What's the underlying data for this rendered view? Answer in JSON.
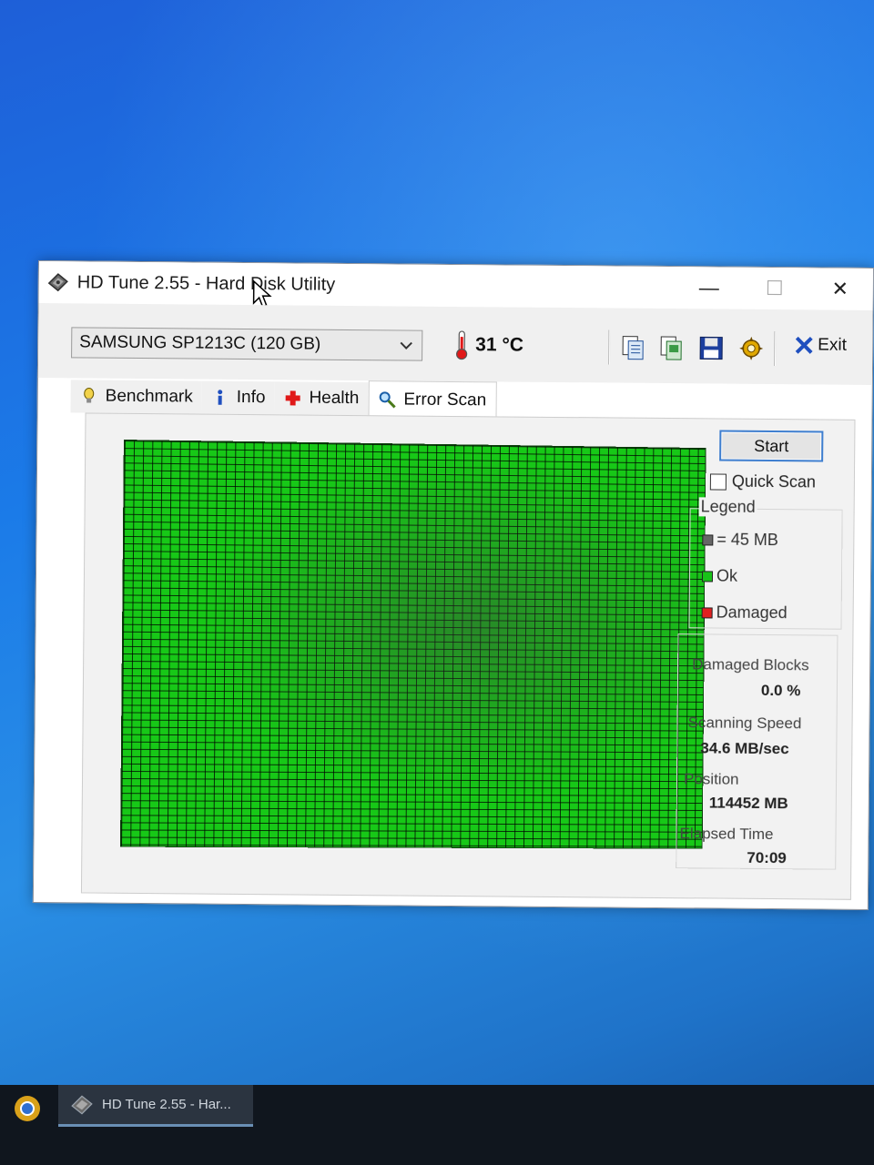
{
  "window": {
    "title": "HD Tune 2.55 - Hard Disk Utility",
    "minimize": "—",
    "maximize": "☐",
    "close": "✕"
  },
  "toolbar": {
    "drive": "SAMSUNG SP1213C (120 GB)",
    "temperature": "31 °C",
    "exit_label": "Exit",
    "icons": [
      "copy-info-icon",
      "copy-screenshot-icon",
      "save-icon",
      "options-icon"
    ]
  },
  "tabs": [
    {
      "label": "Benchmark",
      "icon": "lightbulb-icon"
    },
    {
      "label": "Info",
      "icon": "info-icon"
    },
    {
      "label": "Health",
      "icon": "health-cross-icon"
    },
    {
      "label": "Error Scan",
      "icon": "magnifier-icon",
      "active": true
    }
  ],
  "error_scan": {
    "start_label": "Start",
    "quick_scan_label": "Quick Scan",
    "quick_scan_checked": false,
    "legend_title": "Legend",
    "legend": [
      {
        "label": "= 45 MB",
        "color": "#666666"
      },
      {
        "label": "Ok",
        "color": "#19c219"
      },
      {
        "label": "Damaged",
        "color": "#e02020"
      }
    ],
    "damaged_blocks_label": "Damaged Blocks",
    "damaged_blocks_value": "0.0 %",
    "scanning_speed_label": "Scanning Speed",
    "scanning_speed_value": "34.6 MB/sec",
    "position_label": "Position",
    "position_value": "114452 MB",
    "elapsed_label": "Elapsed Time",
    "elapsed_value": "70:09"
  },
  "taskbar": {
    "item_label": "HD Tune 2.55 - Har..."
  }
}
